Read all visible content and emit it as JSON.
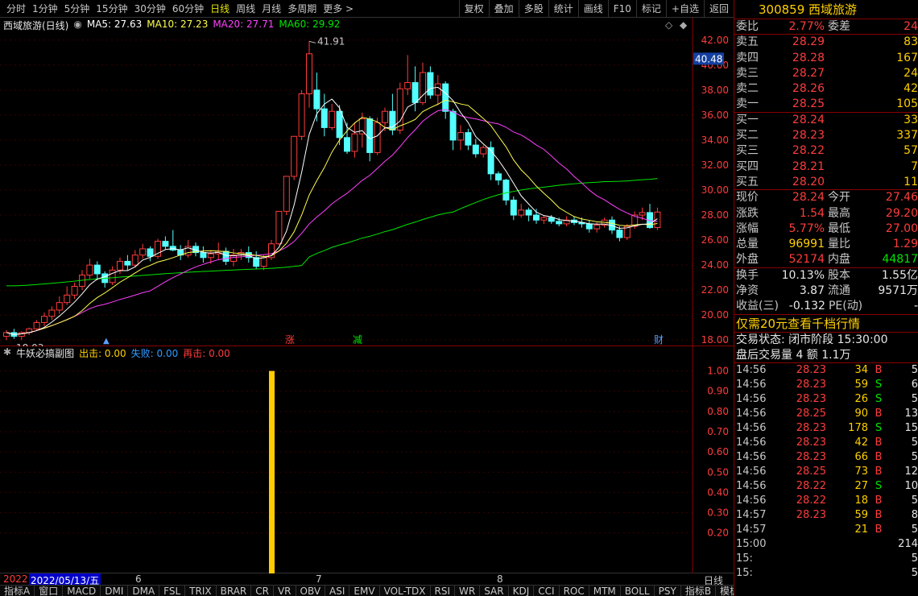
{
  "toolbar": {
    "periods": [
      "分时",
      "1分钟",
      "5分钟",
      "15分钟",
      "30分钟",
      "60分钟",
      "日线",
      "周线",
      "月线",
      "多周期",
      "更多 >"
    ],
    "active_period": "日线",
    "actions": [
      "复权",
      "叠加",
      "多股",
      "统计",
      "画线",
      "F10",
      "标记",
      "+自选",
      "返回"
    ]
  },
  "main_legend": {
    "title": "西域旅游(日线)",
    "ma5": "MA5: 27.63",
    "ma10": "MA10: 27.23",
    "ma20": "MA20: 27.71",
    "ma60": "MA60: 29.92"
  },
  "colors": {
    "up": "#ff3c3c",
    "down": "#54ffff",
    "ma5": "#ffffff",
    "ma10": "#ffff4e",
    "ma20": "#ff40ff",
    "ma60": "#00e600",
    "bg": "#000000",
    "grid": "#8a0000",
    "signal_bar": "#ffcc00"
  },
  "main_axis": {
    "current_price_tag": "40.48",
    "labels": [
      "42.00",
      "40.00",
      "38.00",
      "36.00",
      "34.00",
      "32.00",
      "30.00",
      "28.00",
      "26.00",
      "24.00",
      "22.00",
      "20.00",
      "18.00"
    ]
  },
  "annotations": {
    "high": "41.91",
    "low": "18.03",
    "events": [
      "涨",
      "减",
      "财"
    ]
  },
  "sub_legend": {
    "title": "牛妖必搞副图",
    "out": "出击: 0.00",
    "fail": "失败: 0.00",
    "again": "再击: 0.00"
  },
  "sub_axis": {
    "labels": [
      "1.00",
      "0.90",
      "0.80",
      "0.70",
      "0.60",
      "0.50",
      "0.40",
      "0.30",
      "0.20"
    ]
  },
  "date_bar": {
    "year": "2022",
    "cursor_date": "2022/05/13/五",
    "months": [
      "6",
      "7",
      "8"
    ],
    "period_label": "日线"
  },
  "indicator_tabs": [
    "指标A",
    "窗口",
    "MACD",
    "DMI",
    "DMA",
    "FSL",
    "TRIX",
    "BRAR",
    "CR",
    "VR",
    "OBV",
    "ASI",
    "EMV",
    "VOL-TDX",
    "RSI",
    "WR",
    "SAR",
    "KDJ",
    "CCI",
    "ROC",
    "MTM",
    "BOLL",
    "PSY"
  ],
  "tab_right": [
    "指标B",
    "模板",
    "+",
    "-"
  ],
  "chart_data": {
    "type": "candlestick",
    "ylim": [
      17.5,
      42.5
    ],
    "candles": [
      [
        18.3,
        18.8,
        18.0,
        18.6
      ],
      [
        18.6,
        18.9,
        18.1,
        18.3
      ],
      [
        18.3,
        18.7,
        18.0,
        18.6
      ],
      [
        18.6,
        19.0,
        18.4,
        18.9
      ],
      [
        18.9,
        19.6,
        18.8,
        19.4
      ],
      [
        19.4,
        20.2,
        19.1,
        19.9
      ],
      [
        19.9,
        20.7,
        19.6,
        20.4
      ],
      [
        20.4,
        21.5,
        20.1,
        21.0
      ],
      [
        21.0,
        22.3,
        20.8,
        21.6
      ],
      [
        21.6,
        22.6,
        21.3,
        22.3
      ],
      [
        22.3,
        23.6,
        22.0,
        23.2
      ],
      [
        23.2,
        24.5,
        22.9,
        24.0
      ],
      [
        24.0,
        24.3,
        22.8,
        23.3
      ],
      [
        23.3,
        23.5,
        22.2,
        22.6
      ],
      [
        22.6,
        23.9,
        22.4,
        23.6
      ],
      [
        23.6,
        24.6,
        23.3,
        24.3
      ],
      [
        24.3,
        24.8,
        23.6,
        24.0
      ],
      [
        24.0,
        25.2,
        23.8,
        24.8
      ],
      [
        24.8,
        25.7,
        24.5,
        25.3
      ],
      [
        25.3,
        25.5,
        24.3,
        24.7
      ],
      [
        24.7,
        26.1,
        24.5,
        25.9
      ],
      [
        25.9,
        26.3,
        25.2,
        25.5
      ],
      [
        25.5,
        26.8,
        25.1,
        25.2
      ],
      [
        25.2,
        25.6,
        24.4,
        24.8
      ],
      [
        24.8,
        26.0,
        24.6,
        25.5
      ],
      [
        25.5,
        25.8,
        24.7,
        25.0
      ],
      [
        25.0,
        25.5,
        24.2,
        24.6
      ],
      [
        24.6,
        25.2,
        24.1,
        24.9
      ],
      [
        24.9,
        25.8,
        24.4,
        25.1
      ],
      [
        25.1,
        25.4,
        24.0,
        24.3
      ],
      [
        24.3,
        25.3,
        23.9,
        24.8
      ],
      [
        24.8,
        25.3,
        24.4,
        25.0
      ],
      [
        25.0,
        25.5,
        24.2,
        24.6
      ],
      [
        24.6,
        25.1,
        23.7,
        23.9
      ],
      [
        23.9,
        24.8,
        23.6,
        24.6
      ],
      [
        24.6,
        26.0,
        24.4,
        25.7
      ],
      [
        25.7,
        28.3,
        25.6,
        28.3
      ],
      [
        28.3,
        31.1,
        28.0,
        31.1
      ],
      [
        31.1,
        34.3,
        30.8,
        34.3
      ],
      [
        34.3,
        38.0,
        34.0,
        37.7
      ],
      [
        37.7,
        41.9,
        36.6,
        40.9
      ],
      [
        38.0,
        39.4,
        35.5,
        36.5
      ],
      [
        36.5,
        37.7,
        34.3,
        35.0
      ],
      [
        35.0,
        36.9,
        34.8,
        36.3
      ],
      [
        36.3,
        36.8,
        33.6,
        34.2
      ],
      [
        34.2,
        35.4,
        32.9,
        33.1
      ],
      [
        33.1,
        35.4,
        32.6,
        34.5
      ],
      [
        34.5,
        36.2,
        33.4,
        35.7
      ],
      [
        35.7,
        35.9,
        32.3,
        33.0
      ],
      [
        33.0,
        35.8,
        32.8,
        35.4
      ],
      [
        35.4,
        36.6,
        34.7,
        36.3
      ],
      [
        36.3,
        37.7,
        34.4,
        34.8
      ],
      [
        34.8,
        38.6,
        34.5,
        38.1
      ],
      [
        38.1,
        40.8,
        37.6,
        38.6
      ],
      [
        38.6,
        39.9,
        36.3,
        37.0
      ],
      [
        37.0,
        40.2,
        36.8,
        39.4
      ],
      [
        39.4,
        39.9,
        37.3,
        37.6
      ],
      [
        37.6,
        39.2,
        36.8,
        38.5
      ],
      [
        38.5,
        38.7,
        35.7,
        36.3
      ],
      [
        36.3,
        36.5,
        33.2,
        34.0
      ],
      [
        34.0,
        35.2,
        33.2,
        34.6
      ],
      [
        34.6,
        34.9,
        33.2,
        33.6
      ],
      [
        33.6,
        34.1,
        32.6,
        32.9
      ],
      [
        32.9,
        33.6,
        32.6,
        33.4
      ],
      [
        33.4,
        33.9,
        30.8,
        31.3
      ],
      [
        31.3,
        31.5,
        30.4,
        30.8
      ],
      [
        30.8,
        30.9,
        28.8,
        29.2
      ],
      [
        29.2,
        29.5,
        27.6,
        28.0
      ],
      [
        28.0,
        28.9,
        27.8,
        28.4
      ],
      [
        28.4,
        28.6,
        27.5,
        28.0
      ],
      [
        28.0,
        28.5,
        27.3,
        27.6
      ],
      [
        27.6,
        28.0,
        27.3,
        27.8
      ],
      [
        27.8,
        28.0,
        27.3,
        27.5
      ],
      [
        27.5,
        27.8,
        27.1,
        27.3
      ],
      [
        27.3,
        27.9,
        27.1,
        27.6
      ],
      [
        27.6,
        27.9,
        27.2,
        27.4
      ],
      [
        27.4,
        27.8,
        27.0,
        27.3
      ],
      [
        27.3,
        27.6,
        26.6,
        26.9
      ],
      [
        26.9,
        27.4,
        26.6,
        27.2
      ],
      [
        27.2,
        27.8,
        27.0,
        27.6
      ],
      [
        27.6,
        27.9,
        26.5,
        26.8
      ],
      [
        26.8,
        27.1,
        25.9,
        26.2
      ],
      [
        26.2,
        27.3,
        26.0,
        27.1
      ],
      [
        27.1,
        28.3,
        26.9,
        28.0
      ],
      [
        28.0,
        28.6,
        27.6,
        28.2
      ],
      [
        28.2,
        28.9,
        26.9,
        27.0
      ],
      [
        27.0,
        28.6,
        26.8,
        28.24
      ]
    ],
    "sub_bars": [
      {
        "index": 40,
        "value": 1.0
      }
    ],
    "sub_ylim": [
      0,
      1.05
    ]
  },
  "side": {
    "header": "300859 西域旅游",
    "weibi": {
      "k": "委比",
      "v": "2.77%",
      "k2": "委差",
      "v2": "24"
    },
    "asks": [
      {
        "k": "卖五",
        "p": "28.29",
        "q": "83"
      },
      {
        "k": "卖四",
        "p": "28.28",
        "q": "167"
      },
      {
        "k": "卖三",
        "p": "28.27",
        "q": "24"
      },
      {
        "k": "卖二",
        "p": "28.26",
        "q": "42"
      },
      {
        "k": "卖一",
        "p": "28.25",
        "q": "105"
      }
    ],
    "bids": [
      {
        "k": "买一",
        "p": "28.24",
        "q": "33"
      },
      {
        "k": "买二",
        "p": "28.23",
        "q": "337"
      },
      {
        "k": "买三",
        "p": "28.22",
        "q": "57"
      },
      {
        "k": "买四",
        "p": "28.21",
        "q": "7"
      },
      {
        "k": "买五",
        "p": "28.20",
        "q": "11"
      }
    ],
    "stats": [
      {
        "k": "现价",
        "v": "28.24",
        "vc": "red",
        "k2": "今开",
        "v2": "27.46",
        "v2c": "red"
      },
      {
        "k": "涨跌",
        "v": "1.54",
        "vc": "red",
        "k2": "最高",
        "v2": "29.20",
        "v2c": "red"
      },
      {
        "k": "涨幅",
        "v": "5.77%",
        "vc": "red",
        "k2": "最低",
        "v2": "27.00",
        "v2c": "red"
      },
      {
        "k": "总量",
        "v": "96991",
        "vc": "yellow",
        "k2": "量比",
        "v2": "1.29",
        "v2c": "red"
      },
      {
        "k": "外盘",
        "v": "52174",
        "vc": "red",
        "k2": "内盘",
        "v2": "44817",
        "v2c": "green"
      }
    ],
    "stats2": [
      {
        "k": "换手",
        "v": "10.13%",
        "k2": "股本",
        "v2": "1.55亿"
      },
      {
        "k": "净资",
        "v": "3.87",
        "k2": "流通",
        "v2": "9571万"
      },
      {
        "k": "收益(三)",
        "v": "-0.132",
        "k2": "PE(动)",
        "v2": "-"
      }
    ],
    "promo": "仅需20元查看千档行情",
    "trade_state": "交易状态: 闭市阶段 15:30:00",
    "after_hours": "盘后交易量 4 额 1.1万",
    "ticks": [
      {
        "t": "14:56",
        "p": "28.23",
        "q": "34",
        "d": "B",
        "x": "5"
      },
      {
        "t": "14:56",
        "p": "28.23",
        "q": "59",
        "d": "S",
        "x": "6"
      },
      {
        "t": "14:56",
        "p": "28.23",
        "q": "26",
        "d": "S",
        "x": "5"
      },
      {
        "t": "14:56",
        "p": "28.25",
        "q": "90",
        "d": "B",
        "x": "13"
      },
      {
        "t": "14:56",
        "p": "28.23",
        "q": "178",
        "d": "S",
        "x": "15"
      },
      {
        "t": "14:56",
        "p": "28.23",
        "q": "42",
        "d": "B",
        "x": "5"
      },
      {
        "t": "14:56",
        "p": "28.23",
        "q": "66",
        "d": "B",
        "x": "5"
      },
      {
        "t": "14:56",
        "p": "28.25",
        "q": "73",
        "d": "B",
        "x": "12"
      },
      {
        "t": "14:56",
        "p": "28.22",
        "q": "27",
        "d": "S",
        "x": "10"
      },
      {
        "t": "14:56",
        "p": "28.22",
        "q": "18",
        "d": "B",
        "x": "5"
      },
      {
        "t": "14:57",
        "p": "28.23",
        "q": "59",
        "d": "B",
        "x": "8"
      },
      {
        "t": "14:57",
        "p": "",
        "q": "21",
        "d": "B",
        "x": "5"
      },
      {
        "t": "15:00",
        "p": "",
        "q": "",
        "d": "",
        "x": "214"
      },
      {
        "t": "15:",
        "p": "",
        "q": "",
        "d": "",
        "x": "5"
      },
      {
        "t": "15:",
        "p": "",
        "q": "",
        "d": "",
        "x": "5"
      }
    ]
  }
}
